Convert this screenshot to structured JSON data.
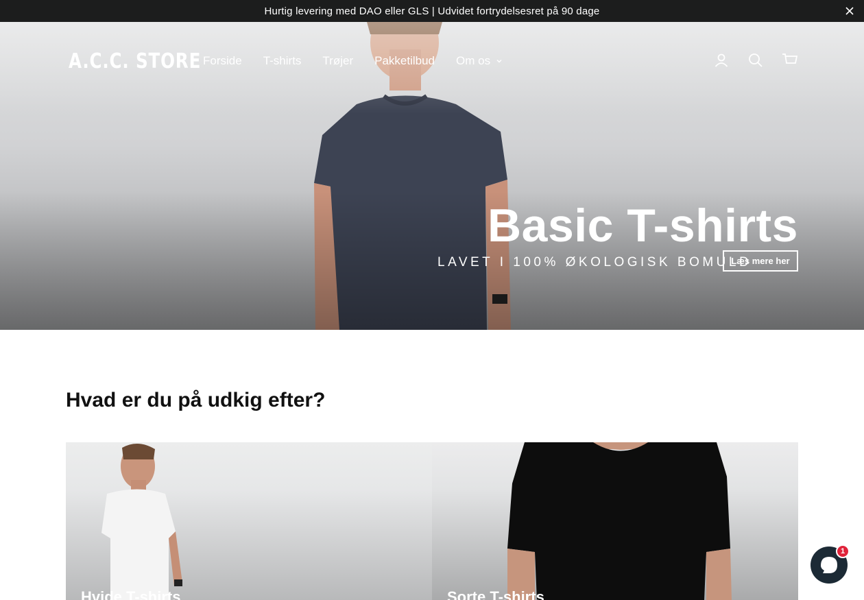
{
  "announcement": {
    "text": "Hurtig levering med DAO eller GLS | Udvidet fortrydelsesret på 90 dage",
    "close_icon": "close-icon"
  },
  "header": {
    "logo": "A.C.C. STORE",
    "nav": [
      {
        "label": "Forside"
      },
      {
        "label": "T-shirts"
      },
      {
        "label": "Trøjer"
      },
      {
        "label": "Pakketilbud"
      },
      {
        "label": "Om os",
        "has_dropdown": true
      }
    ],
    "icons": [
      "account-icon",
      "search-icon",
      "cart-icon"
    ]
  },
  "hero": {
    "title": "Basic T-shirts",
    "subtitle": "LAVET I 100% ØKOLOGISK BOMULD",
    "button": "Læs mere her"
  },
  "section": {
    "title": "Hvad er du på udkig efter?",
    "cards": [
      {
        "label": "Hvide T-shirts"
      },
      {
        "label": "Sorte T-shirts"
      }
    ]
  },
  "chat": {
    "badge": "1",
    "icon": "chat-icon",
    "color": "#1c2a35"
  },
  "colors": {
    "announcement_bg": "#1c1d1d",
    "badge": "#e0233a"
  }
}
